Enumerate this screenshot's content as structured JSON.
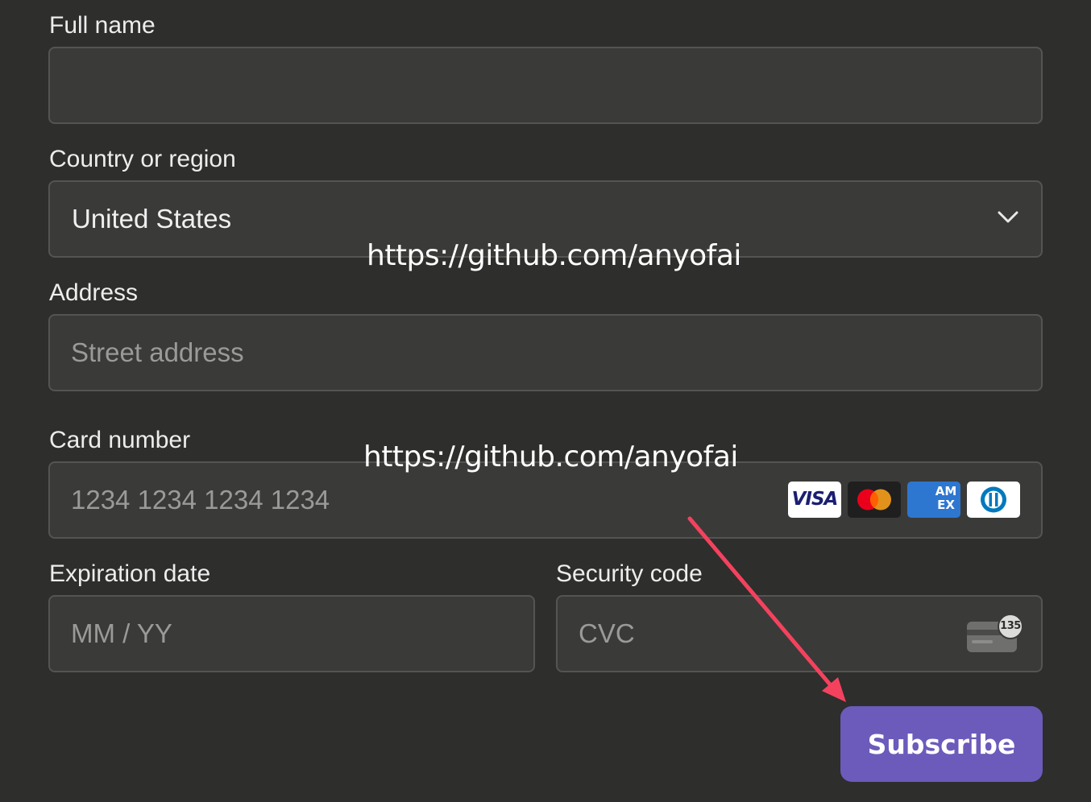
{
  "form": {
    "full_name": {
      "label": "Full name",
      "value": "",
      "placeholder": ""
    },
    "country": {
      "label": "Country or region",
      "selected": "United States",
      "icon": "chevron-down-icon"
    },
    "address": {
      "label": "Address",
      "value": "",
      "placeholder": "Street address"
    },
    "card_number": {
      "label": "Card number",
      "value": "",
      "placeholder": "1234 1234 1234 1234",
      "brands": [
        "VISA",
        "Mastercard",
        "American Express",
        "Diners Club"
      ],
      "amex_text": [
        "AM",
        "EX"
      ]
    },
    "expiration": {
      "label": "Expiration date",
      "value": "",
      "placeholder": "MM / YY"
    },
    "security_code": {
      "label": "Security code",
      "value": "",
      "placeholder": "CVC",
      "icon_text": "135"
    }
  },
  "subscribe_label": "Subscribe",
  "watermarks": [
    "https://github.com/anyofai",
    "https://github.com/anyofai"
  ],
  "colors": {
    "background": "#2e2e2c",
    "field_background": "#3a3a39",
    "field_border": "#545453",
    "button": "#6c5bbb",
    "annotation_arrow": "#f4425e"
  }
}
